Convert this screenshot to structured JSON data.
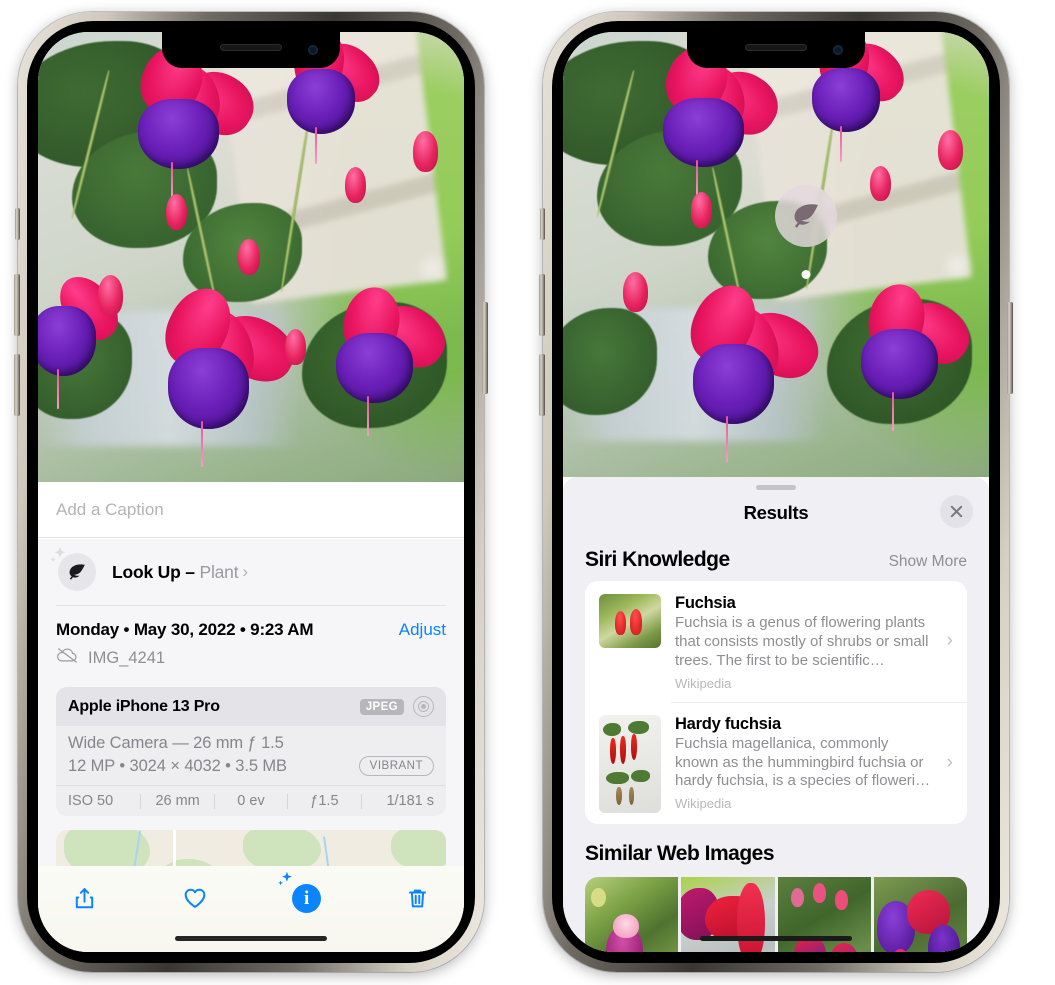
{
  "left_phone": {
    "caption_field": {
      "placeholder": "Add a Caption",
      "value": ""
    },
    "lookup_row": {
      "icon": "leaf-icon",
      "sparkle_icon": "sparkles-icon",
      "label": "Look Up",
      "separator": "–",
      "subject": "Plant",
      "chevron": "›"
    },
    "date_row": {
      "date_text": "Monday • May 30, 2022 • 9:23 AM",
      "adjust_label": "Adjust",
      "cloud_icon": "cloud-slash-icon",
      "file_name": "IMG_4241"
    },
    "camera_card": {
      "model": "Apple iPhone 13 Pro",
      "format_badge": "JPEG",
      "aperture_icon": "aperture-icon",
      "lens": "Wide Camera — 26 mm ƒ 1.5",
      "specs": "12 MP • 3024 × 4032 • 3.5 MB",
      "style_badge": "VIBRANT",
      "exif": [
        "ISO 50",
        "26 mm",
        "0 ev",
        "ƒ1.5",
        "1/181 s"
      ]
    },
    "map_card": {
      "pin": "photo-thumbnail-pin"
    },
    "toolbar": {
      "buttons": [
        {
          "name": "share-button",
          "icon": "share-icon"
        },
        {
          "name": "favorite-button",
          "icon": "heart-icon"
        },
        {
          "name": "info-button",
          "icon": "info-sparkle-icon",
          "active": true,
          "glyph": "i"
        },
        {
          "name": "delete-button",
          "icon": "trash-icon"
        }
      ],
      "accent_color": "#0a84ff"
    }
  },
  "right_phone": {
    "overlay_badge": {
      "icon": "leaf-icon",
      "label": "visual-look-up-badge"
    },
    "sheet": {
      "title": "Results",
      "close_icon": "close-icon",
      "grabber": "drag-handle"
    },
    "siri_knowledge": {
      "heading": "Siri Knowledge",
      "action": "Show More",
      "items": [
        {
          "title": "Fuchsia",
          "description": "Fuchsia is a genus of flowering plants that consists mostly of shrubs or small trees. The first to be scientific…",
          "source": "Wikipedia",
          "chevron": "›"
        },
        {
          "title": "Hardy fuchsia",
          "description": "Fuchsia magellanica, commonly known as the hummingbird fuchsia or hardy fuchsia, is a species of floweri…",
          "source": "Wikipedia",
          "chevron": "›"
        }
      ]
    },
    "similar_web_images": {
      "heading": "Similar Web Images",
      "thumbnails": [
        "fuchsia-thumb-1",
        "fuchsia-thumb-2",
        "fuchsia-thumb-3",
        "fuchsia-thumb-4"
      ]
    }
  },
  "colors": {
    "accent_blue": "#0a84ff",
    "sheet_background": "#efeff4",
    "card_white": "#ffffff",
    "secondary_text": "#8e8e93"
  }
}
